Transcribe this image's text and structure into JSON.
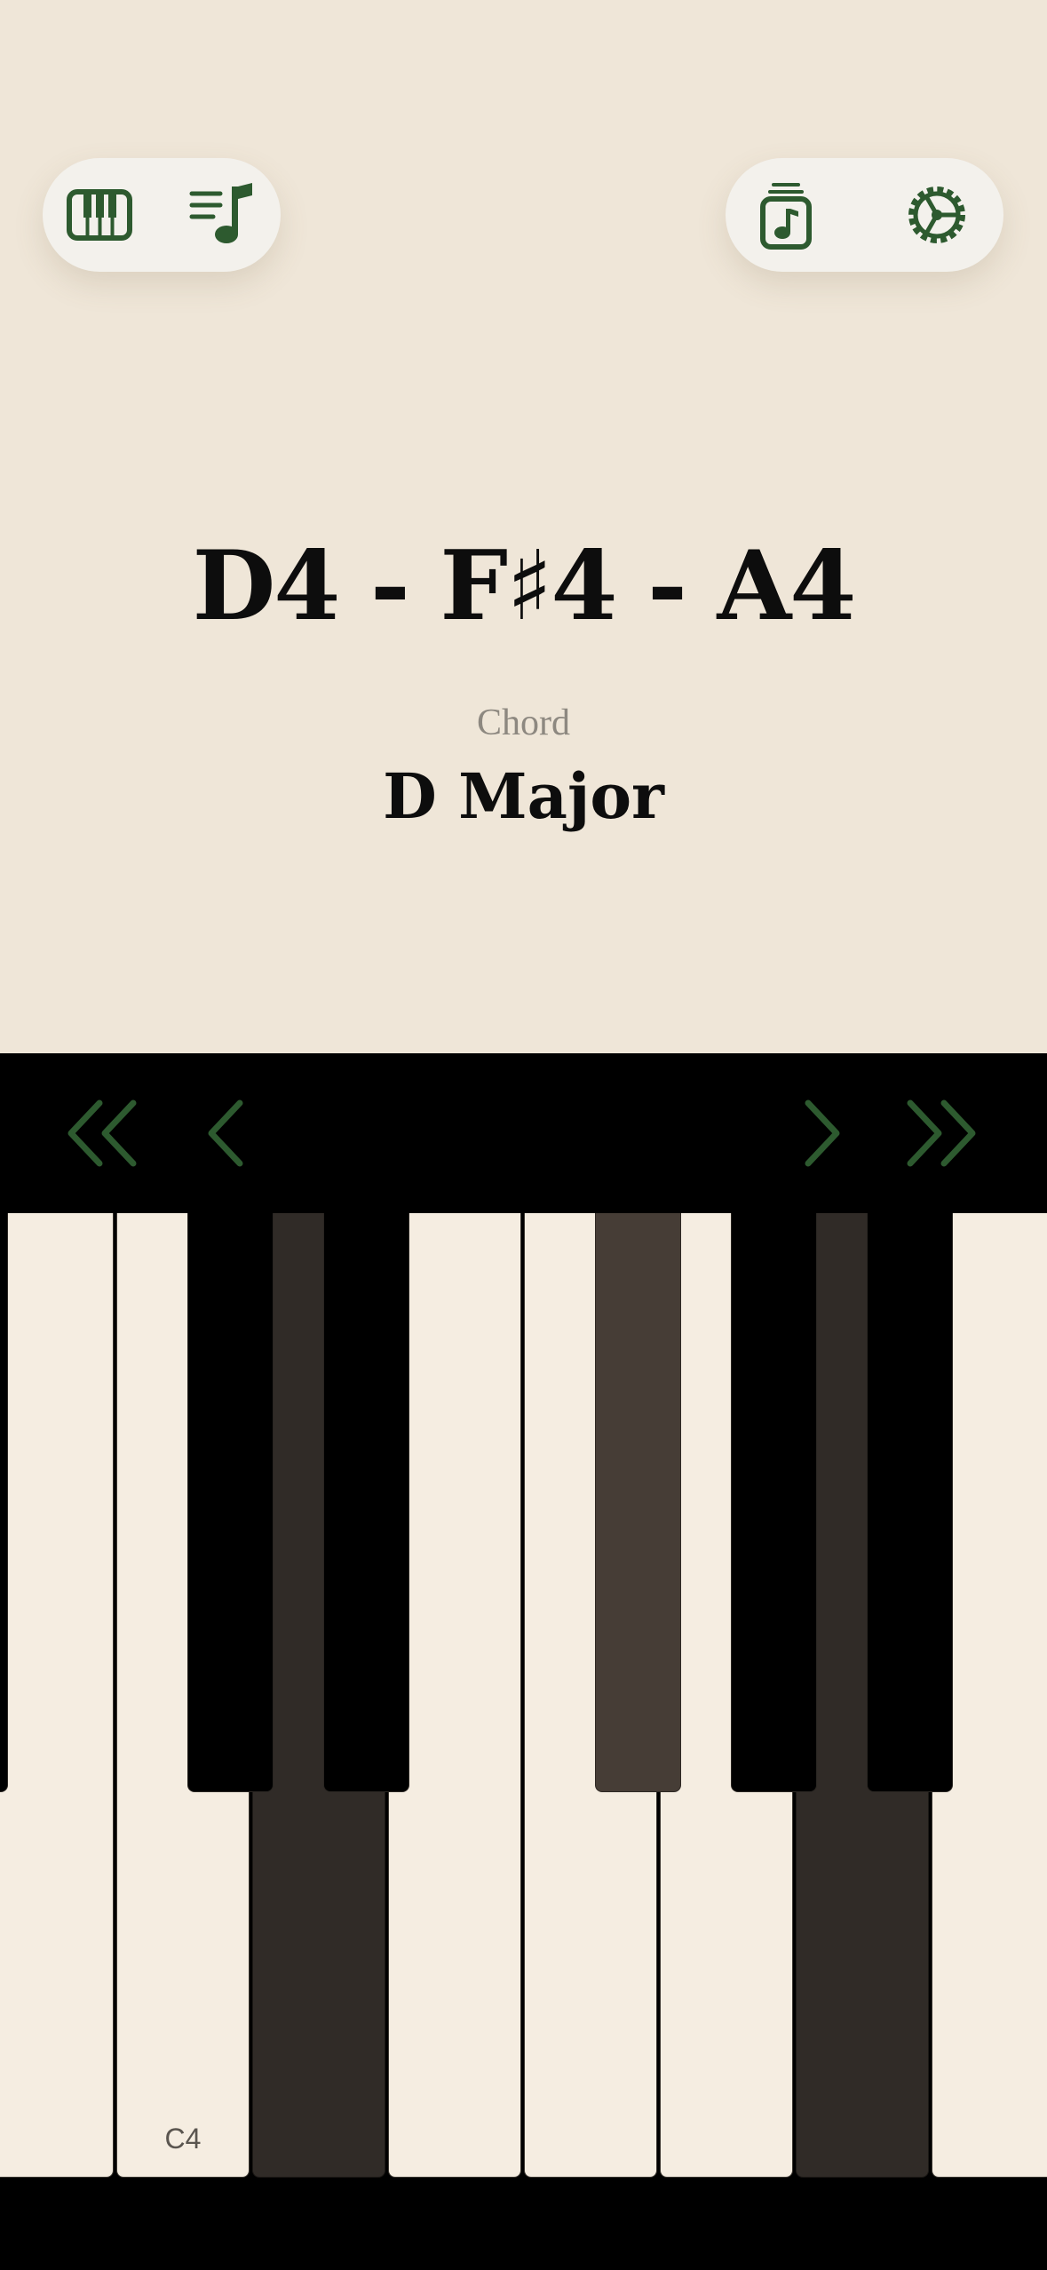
{
  "toolbar": {
    "left_icons": [
      "piano-icon",
      "playlist-icon"
    ],
    "right_icons": [
      "music-library-icon",
      "settings-gear-icon"
    ],
    "icon_color": "#2d5a2f"
  },
  "display": {
    "notes": "D4 - F♯4 - A4",
    "chord_label": "Chord",
    "chord_name": "D Major"
  },
  "navigation": {
    "buttons": [
      "double-chevron-left-icon",
      "chevron-left-icon",
      "chevron-right-icon",
      "double-chevron-right-icon"
    ],
    "color": "#2d5a2f"
  },
  "keyboard": {
    "label": "C4",
    "pressed_keys": [
      "D4",
      "F#4",
      "A4"
    ]
  }
}
